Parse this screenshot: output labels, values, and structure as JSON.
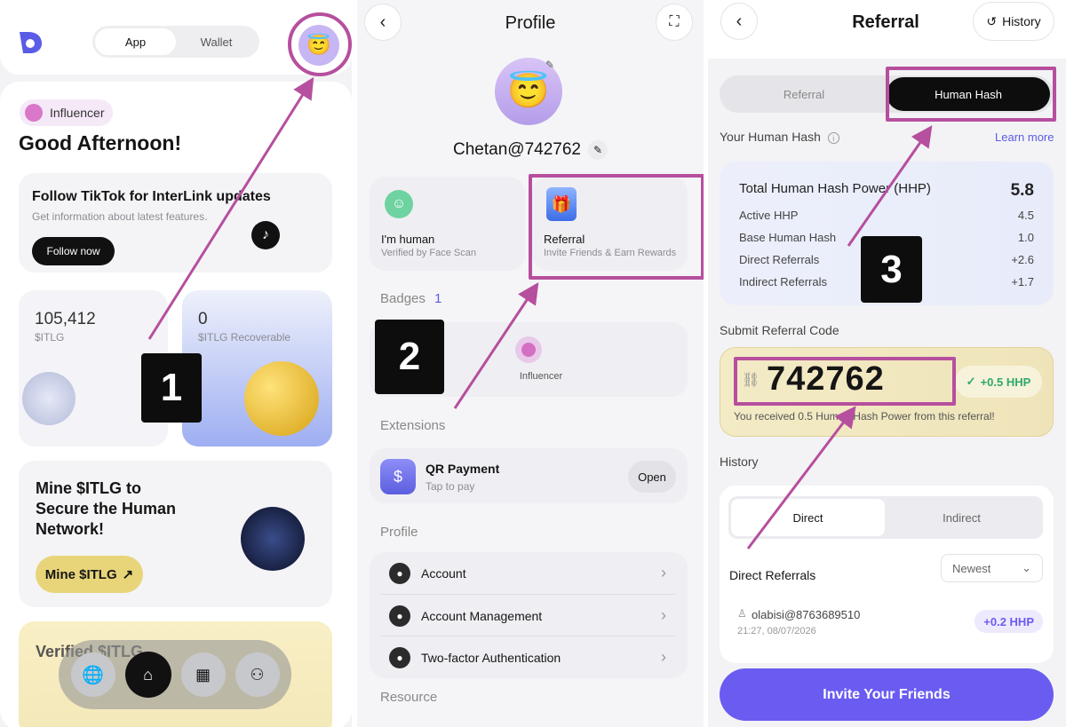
{
  "screen1": {
    "tabs": [
      "App",
      "Wallet"
    ],
    "badge": "Influencer",
    "greeting": "Good Afternoon!",
    "tiktok": {
      "title": "Follow TikTok for InterLink updates",
      "subtitle": "Get information about latest features.",
      "button": "Follow now"
    },
    "balance": {
      "value": "105,412",
      "unit": "$ITLG"
    },
    "recoverable": {
      "value": "0",
      "unit": "$ITLG Recoverable"
    },
    "mine": {
      "title": "Mine $ITLG to Secure the Human Network!",
      "button": "Mine $ITLG",
      "button_arrow": "↗"
    },
    "verified": {
      "title": "Verified $ITLG"
    },
    "step": "1"
  },
  "screen2": {
    "title": "Profile",
    "username": "Chetan@742762",
    "human": {
      "title": "I'm human",
      "subtitle": "Verified by Face Scan"
    },
    "referral": {
      "title": "Referral",
      "subtitle": "Invite Friends & Earn Rewards"
    },
    "badges_label": "Badges",
    "badges_count": "1",
    "badge_item": "Influencer",
    "extensions_label": "Extensions",
    "qr": {
      "title": "QR Payment",
      "subtitle": "Tap to pay",
      "button": "Open"
    },
    "profile_label": "Profile",
    "profile_items": [
      "Account",
      "Account Management",
      "Two-factor Authentication"
    ],
    "resource_label": "Resource",
    "step": "2"
  },
  "screen3": {
    "title": "Referral",
    "history_button": "History",
    "tabs": [
      "Referral",
      "Human Hash"
    ],
    "your_hash": "Your Human Hash",
    "learn_more": "Learn more",
    "total": {
      "label": "Total Human Hash Power (HHP)",
      "value": "5.8"
    },
    "rows": [
      {
        "label": "Active HHP",
        "value": "4.5"
      },
      {
        "label": "Base Human Hash",
        "value": "1.0"
      },
      {
        "label": "Direct Referrals",
        "value": "+2.6"
      },
      {
        "label": "Indirect Referrals",
        "value": "+1.7"
      }
    ],
    "submit_label": "Submit Referral Code",
    "code": "742762",
    "code_reward": "+0.5 HHP",
    "code_note": "You received 0.5 Human Hash Power from this referral!",
    "history_label": "History",
    "history_tabs": [
      "Direct",
      "Indirect"
    ],
    "direct_referrals": "Direct Referrals",
    "sort": "Newest",
    "entry": {
      "user": "olabisi@8763689510",
      "time": "21:27, 08/07/2026",
      "reward": "+0.2 HHP"
    },
    "invite_button": "Invite Your Friends",
    "step": "3"
  },
  "colors": {
    "accent": "#b64f9e",
    "purple": "#6a5cf0",
    "green": "#2ea86a"
  }
}
